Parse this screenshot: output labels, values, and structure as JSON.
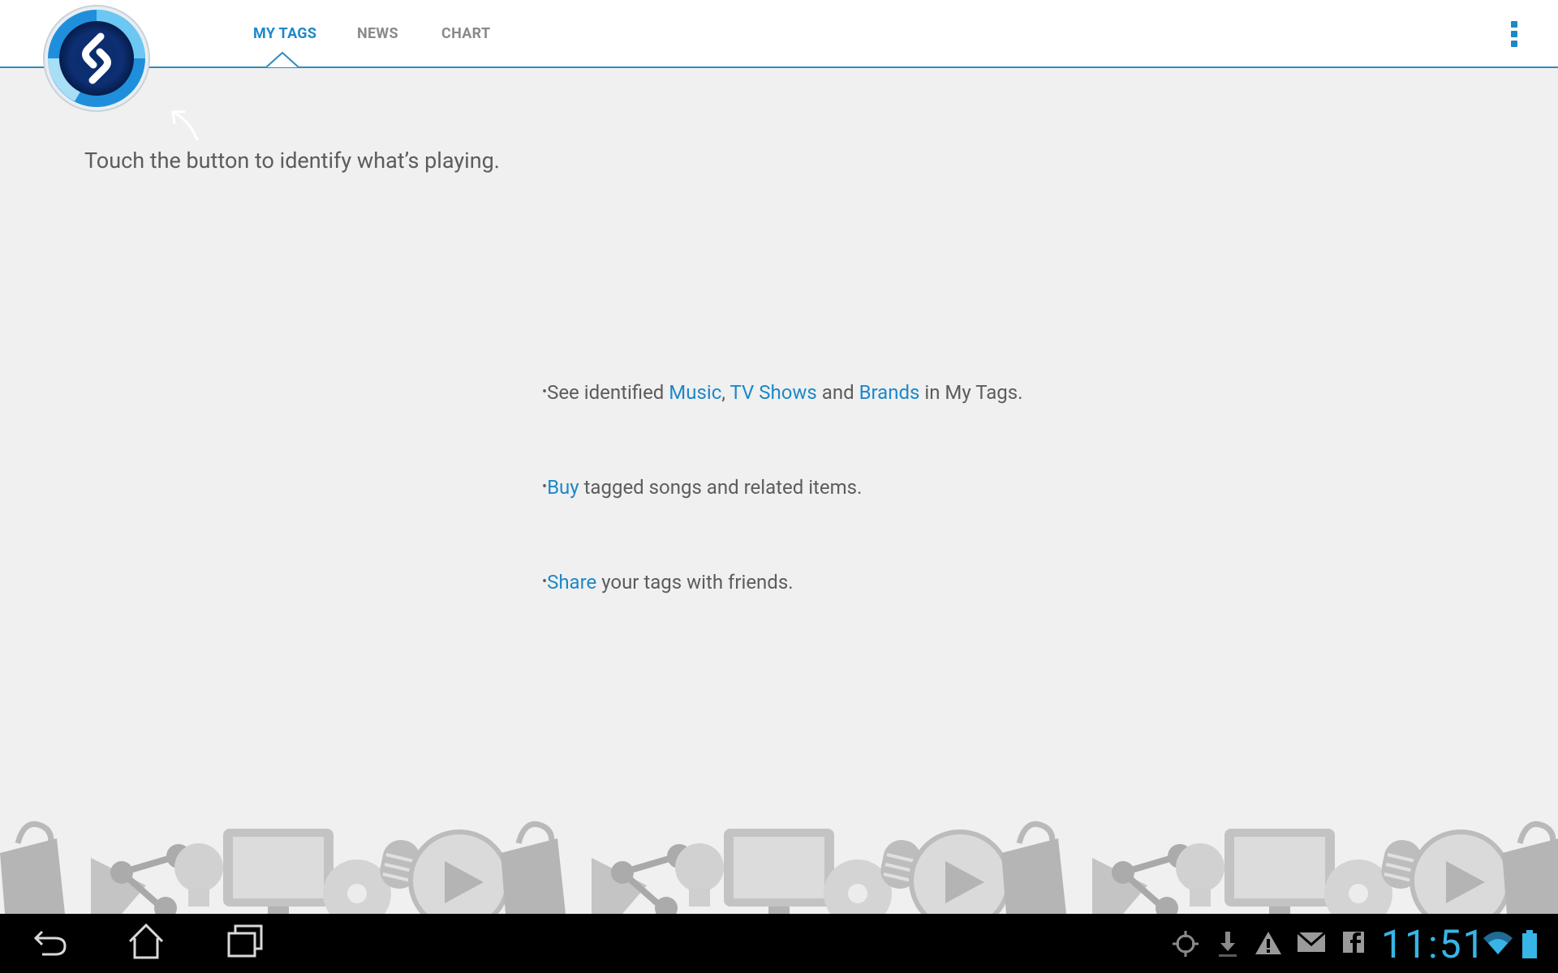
{
  "tabs": [
    {
      "label": "MY TAGS",
      "active": true
    },
    {
      "label": "NEWS",
      "active": false
    },
    {
      "label": "CHART",
      "active": false
    }
  ],
  "accent_color": "#1d88c9",
  "hint": "Touch the button to identify what’s playing.",
  "features": {
    "bullet": "•",
    "line1": {
      "a": "See identified ",
      "music": "Music",
      "comma": ",",
      "tv": "TV Shows",
      "and": " and ",
      "brands": "Brands",
      "b": " in My Tags."
    },
    "line2": {
      "buy": "Buy",
      "b": " tagged songs and related items."
    },
    "line3": {
      "share": "Share",
      "b": " your tags with friends."
    }
  },
  "banner_icons": [
    "shopping-bag-icon",
    "share-icon",
    "lightbulb-icon",
    "tv-icon",
    "disc-icon",
    "microphone-icon",
    "play-icon"
  ],
  "status_bar": {
    "time": "11:51",
    "icons": [
      "gps-icon",
      "download-icon",
      "warning-icon",
      "gmail-icon",
      "facebook-icon",
      "wifi-icon",
      "battery-icon"
    ]
  }
}
